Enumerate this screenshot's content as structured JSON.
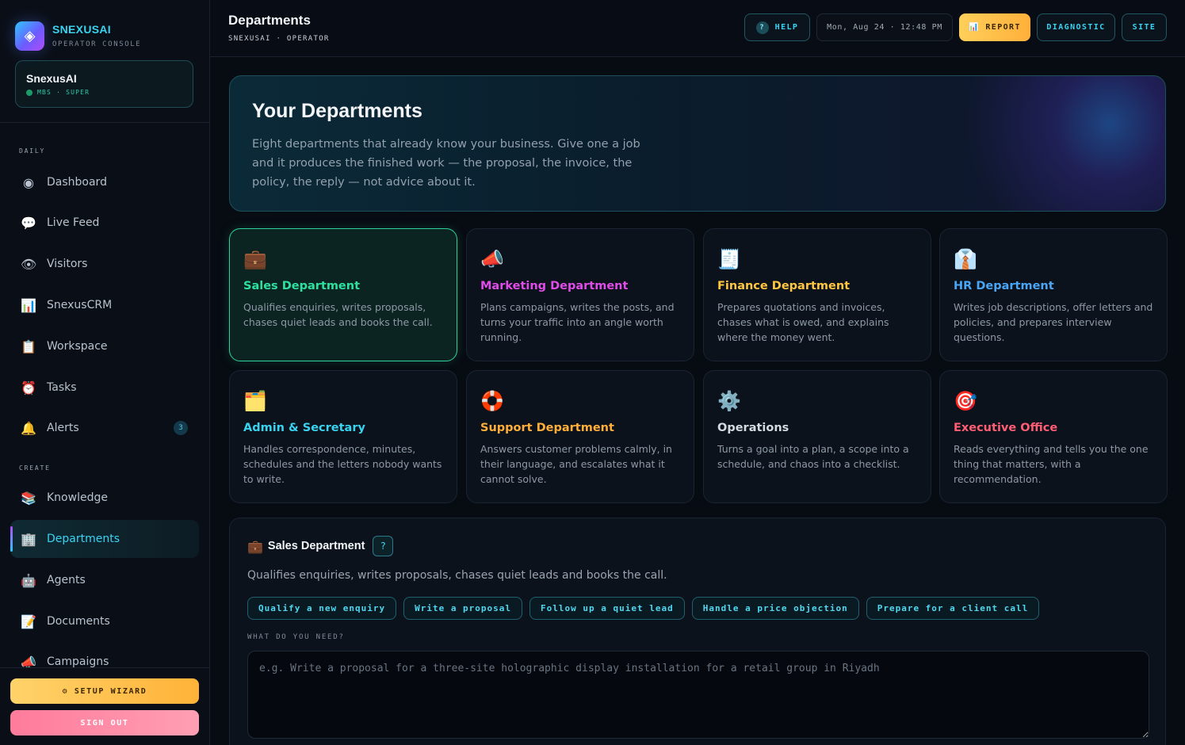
{
  "brand": {
    "name": "SNEXUSAI",
    "subtitle": "OPERATOR CONSOLE",
    "logo_icon": "◈"
  },
  "user": {
    "name": "SnexusAI",
    "meta": "MBS · SUPER",
    "status_color": "#1b9b6a"
  },
  "sidebar": {
    "sections": [
      {
        "label": "DAILY"
      },
      {
        "label": "CREATE"
      }
    ],
    "items": [
      {
        "label": "Dashboard",
        "icon": "◉",
        "icon_name": "dashboard-icon"
      },
      {
        "label": "Live Feed",
        "icon": "💬",
        "icon_name": "chat-bubble-icon"
      },
      {
        "label": "Visitors",
        "icon": "👁",
        "icon_name": "eye-icon"
      },
      {
        "label": "SnexusCRM",
        "icon": "📊",
        "icon_name": "bar-chart-icon"
      },
      {
        "label": "Workspace",
        "icon": "📋",
        "icon_name": "clipboard-icon"
      },
      {
        "label": "Tasks",
        "icon": "⏰",
        "icon_name": "alarm-clock-icon"
      },
      {
        "label": "Alerts",
        "icon": "🔔",
        "icon_name": "bell-icon",
        "badge": "3"
      },
      {
        "label": "Knowledge",
        "icon": "📚",
        "icon_name": "books-icon"
      },
      {
        "label": "Departments",
        "icon": "🏢",
        "icon_name": "office-building-icon",
        "active": true
      },
      {
        "label": "Agents",
        "icon": "🤖",
        "icon_name": "robot-icon"
      },
      {
        "label": "Documents",
        "icon": "📝",
        "icon_name": "memo-icon"
      },
      {
        "label": "Campaigns",
        "icon": "📣",
        "icon_name": "megaphone-icon"
      }
    ],
    "setup_label": "⚙ SETUP WIZARD",
    "signout_label": "SIGN OUT"
  },
  "header": {
    "title": "Departments",
    "breadcrumb": "SNEXUSAI · OPERATOR",
    "help_label": "HELP",
    "help_icon": "?",
    "clock": "Mon, Aug 24 · 12:48 PM",
    "report_label": "📊 REPORT",
    "diagnostic_label": "DIAGNOSTIC",
    "site_label": "SITE"
  },
  "hero": {
    "title": "Your Departments",
    "description": "Eight departments that already know your business. Give one a job and it produces the finished work — the proposal, the invoice, the policy, the reply — not advice about it."
  },
  "departments": [
    {
      "name": "Sales Department",
      "icon": "💼",
      "icon_name": "briefcase-icon",
      "color": "#2ee0a0",
      "description": "Qualifies enquiries, writes proposals, chases quiet leads and books the call.",
      "selected": true
    },
    {
      "name": "Marketing Department",
      "icon": "📣",
      "icon_name": "megaphone-icon",
      "color": "#e04ce8",
      "description": "Plans campaigns, writes the posts, and turns your traffic into an angle worth running."
    },
    {
      "name": "Finance Department",
      "icon": "🧾",
      "icon_name": "receipt-icon",
      "color": "#ffc640",
      "description": "Prepares quotations and invoices, chases what is owed, and explains where the money went."
    },
    {
      "name": "HR Department",
      "icon": "👔",
      "icon_name": "necktie-icon",
      "color": "#4aa6f5",
      "description": "Writes job descriptions, offer letters and policies, and prepares interview questions."
    },
    {
      "name": "Admin & Secretary",
      "icon": "🗂️",
      "icon_name": "card-index-icon",
      "color": "#38d3f0",
      "description": "Handles correspondence, minutes, schedules and the letters nobody wants to write."
    },
    {
      "name": "Support Department",
      "icon": "🛟",
      "icon_name": "lifebuoy-icon",
      "color": "#ffae3a",
      "description": "Answers customer problems calmly, in their language, and escalates what it cannot solve."
    },
    {
      "name": "Operations",
      "icon": "⚙️",
      "icon_name": "gear-icon",
      "color": "#d4dae2",
      "description": "Turns a goal into a plan, a scope into a schedule, and chaos into a checklist."
    },
    {
      "name": "Executive Office",
      "icon": "🎯",
      "icon_name": "target-icon",
      "color": "#ff5d73",
      "description": "Reads everything and tells you the one thing that matters, with a recommendation."
    }
  ],
  "detail": {
    "icon": "💼",
    "title": "Sales Department",
    "help_icon": "?",
    "description": "Qualifies enquiries, writes proposals, chases quiet leads and books the call.",
    "chips": [
      "Qualify a new enquiry",
      "Write a proposal",
      "Follow up a quiet lead",
      "Handle a price objection",
      "Prepare for a client call"
    ],
    "need_label": "WHAT DO YOU NEED?",
    "need_placeholder": "e.g. Write a proposal for a three-site holographic display installation for a retail group in Riyadh",
    "need_value": ""
  }
}
